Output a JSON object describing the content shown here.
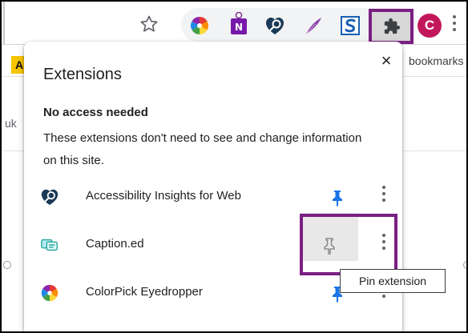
{
  "toolbar": {
    "avatar_initial": "C",
    "extensions_button_label": "Extensions"
  },
  "background": {
    "bookmarks_text": "bookmarks",
    "bookmark_tile_letter": "A",
    "partial_text": "uk"
  },
  "popup": {
    "title": "Extensions",
    "close_glyph": "×",
    "section_heading": "No access needed",
    "section_description": "These extensions don't need to see and change information on this site.",
    "extensions": [
      {
        "name": "Accessibility Insights for Web",
        "icon": "accessibility-insights-icon",
        "pinned": true
      },
      {
        "name": "Caption.ed",
        "icon": "captioned-icon",
        "pinned": false
      },
      {
        "name": "ColorPick Eyedropper",
        "icon": "colorpick-icon",
        "pinned": true
      }
    ],
    "tooltip": "Pin extension"
  },
  "colors": {
    "highlight": "#7b1f83",
    "pin_active": "#1a73e8",
    "pin_inactive": "#8a8a8a",
    "avatar_bg": "#c2185b"
  }
}
